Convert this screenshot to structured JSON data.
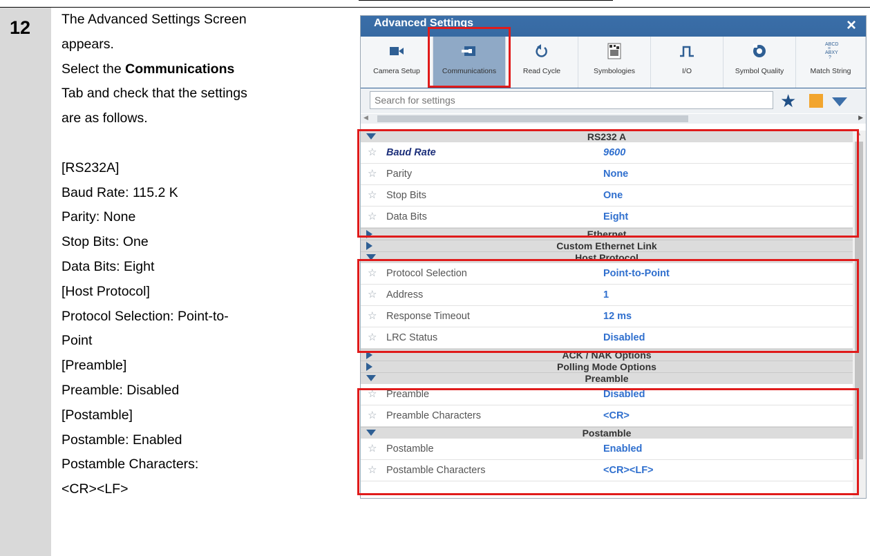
{
  "step": {
    "number": "12",
    "lines": [
      "The Advanced Settings Screen",
      "appears.",
      "Select the |Communications|",
      "Tab and check that the settings",
      "are as follows.",
      "",
      "[RS232A]",
      "Baud Rate: 115.2 K",
      "Parity: None",
      "Stop Bits: One",
      "Data Bits: Eight",
      "[Host Protocol]",
      "Protocol Selection: Point-to-",
      "Point",
      "[Preamble]",
      "Preamble: Disabled",
      "[Postamble]",
      "Postamble: Enabled",
      "Postamble Characters:",
      "<CR><LF>"
    ]
  },
  "dialog": {
    "title": "Advanced Settings",
    "close": "×",
    "tabs": [
      {
        "label": "Camera Setup",
        "icon": "camera-icon"
      },
      {
        "label": "Communications",
        "icon": "communications-icon",
        "active": true
      },
      {
        "label": "Read Cycle",
        "icon": "read-cycle-icon"
      },
      {
        "label": "Symbologies",
        "icon": "symbologies-icon"
      },
      {
        "label": "I/O",
        "icon": "io-pulse-icon"
      },
      {
        "label": "Symbol Quality",
        "icon": "symbol-quality-icon"
      },
      {
        "label": "Match String",
        "icon": "match-string-icon"
      }
    ],
    "search_placeholder": "Search for settings",
    "accent": "#2f5f94",
    "highlight_color": "#e01b1b"
  },
  "settings": [
    {
      "type": "section",
      "title": "RS232 A",
      "expanded": true
    },
    {
      "type": "row",
      "name": "Baud Rate",
      "value": "9600",
      "emphasis": true
    },
    {
      "type": "row",
      "name": "Parity",
      "value": "None"
    },
    {
      "type": "row",
      "name": "Stop Bits",
      "value": "One"
    },
    {
      "type": "row",
      "name": "Data Bits",
      "value": "Eight"
    },
    {
      "type": "section",
      "title": "Ethernet",
      "expanded": false
    },
    {
      "type": "section",
      "title": "Custom Ethernet Link",
      "expanded": false
    },
    {
      "type": "section",
      "title": "Host Protocol",
      "expanded": true
    },
    {
      "type": "row",
      "name": "Protocol Selection",
      "value": "Point-to-Point"
    },
    {
      "type": "row",
      "name": "Address",
      "value": "1"
    },
    {
      "type": "row",
      "name": "Response Timeout",
      "value": "12 ms"
    },
    {
      "type": "row",
      "name": "LRC Status",
      "value": "Disabled"
    },
    {
      "type": "section",
      "title": "ACK / NAK Options",
      "expanded": false
    },
    {
      "type": "section",
      "title": "Polling Mode Options",
      "expanded": false
    },
    {
      "type": "section",
      "title": "Preamble",
      "expanded": true
    },
    {
      "type": "row",
      "name": "Preamble",
      "value": "Disabled"
    },
    {
      "type": "row",
      "name": "Preamble Characters",
      "value": "<CR>"
    },
    {
      "type": "section",
      "title": "Postamble",
      "expanded": true
    },
    {
      "type": "row",
      "name": "Postamble",
      "value": "Enabled"
    },
    {
      "type": "row",
      "name": "Postamble Characters",
      "value": "<CR><LF>"
    }
  ]
}
